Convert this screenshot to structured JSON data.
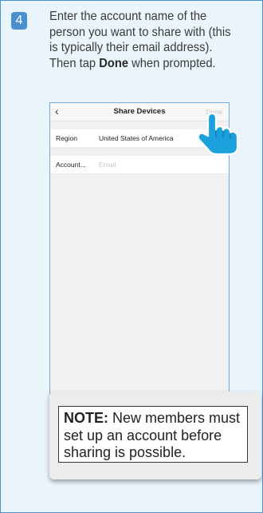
{
  "step": {
    "number": "4",
    "line1": "Enter the account name of the",
    "line2": "person you want to share with (this",
    "line3": "is typically their email address).",
    "line4_prefix": "Then tap ",
    "line4_bold": "Done",
    "line4_suffix": " when prompted."
  },
  "screen": {
    "back_icon": "chevron-left",
    "title": "Share Devices",
    "done": "Done",
    "rows": [
      {
        "label": "Region",
        "value": "United States of America"
      },
      {
        "label": "Account...",
        "placeholder": "Email"
      }
    ]
  },
  "note": {
    "label": "NOTE:",
    "text": " New members must set up an account before sharing is possible."
  },
  "colors": {
    "accent": "#4a8fd0",
    "panel": "#eaf4fb",
    "hand": "#1ba2dc"
  }
}
